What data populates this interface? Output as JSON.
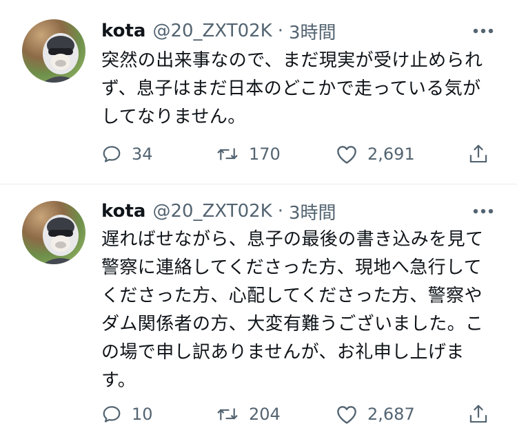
{
  "colors": {
    "text": "#0f1419",
    "secondary": "#536471",
    "divider": "#e6ecf0",
    "background": "#ffffff"
  },
  "icons": {
    "reply": "reply-icon",
    "retweet": "retweet-icon",
    "like": "heart-icon",
    "share": "share-icon",
    "more": "more-icon"
  },
  "tweets": [
    {
      "name": "kota",
      "handle": "@20_ZXT02K",
      "separator": "·",
      "time": "3時間",
      "text": "突然の出来事なので、まだ現実が受け止められ\nず、息子はまだ日本のどこかで走っている気が\nしてなりません。",
      "replies": "34",
      "retweets": "170",
      "likes": "2,691"
    },
    {
      "name": "kota",
      "handle": "@20_ZXT02K",
      "separator": "·",
      "time": "3時間",
      "text": "遅ればせながら、息子の最後の書き込みを見て\n警察に連絡してくださった方、現地へ急行して\nくださった方、心配してくださった方、警察や\nダム関係者の方、大変有難うございました。こ\nの場で申し訳ありませんが、お礼申し上げま\nす。",
      "replies": "10",
      "retweets": "204",
      "likes": "2,687"
    }
  ]
}
